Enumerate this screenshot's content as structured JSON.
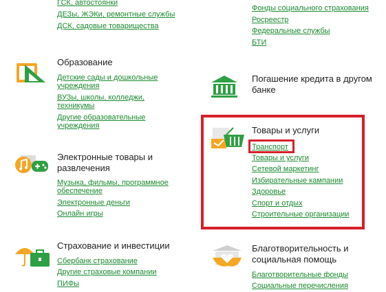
{
  "left": {
    "top_links": [
      "ГСК, автостоянки",
      "ДЕЗы, ЖЭКи, ремонтные службы",
      "ДСК, садовые товарищества"
    ],
    "education": {
      "title": "Образование",
      "links": [
        "Детские сады и дошкольные",
        "учреждения",
        "ВУЗы, школы, колледжи,",
        "техникумы",
        "Другие образовательные",
        "учреждения"
      ]
    },
    "electronics": {
      "title_line1": "Электронные товары и",
      "title_line2": "развлечения",
      "links": [
        "Музыка, фильмы, программное",
        "обеспечение",
        "Электронные деньги",
        "Онлайн игры"
      ]
    },
    "insurance": {
      "title": "Страхование и инвестиции",
      "links": [
        "Сбербанк страхование",
        "Другие страховые компании",
        "ПИФы"
      ]
    }
  },
  "right": {
    "top_links": [
      "Фонды социального страхования",
      "Росреестр",
      "Федеральные службы",
      "БТИ"
    ],
    "loan": {
      "title_line1": "Погашение кредита в другом",
      "title_line2": "банке"
    },
    "goods": {
      "title": "Товары и услуги",
      "links": [
        "Транспорт",
        "Товары и услуги",
        "Сетевой маркетинг",
        "Избирательные кампании",
        "Здоровье",
        "Спорт и отдых",
        "Строительные организации"
      ]
    },
    "charity": {
      "title_line1": "Благотворительность и",
      "title_line2": "социальная помощь",
      "links": [
        "Благотворительные фонды",
        "Социальные перечисления"
      ]
    }
  },
  "colors": {
    "accent_green": "#1a8a2e",
    "icon_green": "#2ea043",
    "icon_orange": "#f5a623",
    "highlight_red": "#d61f2a"
  }
}
